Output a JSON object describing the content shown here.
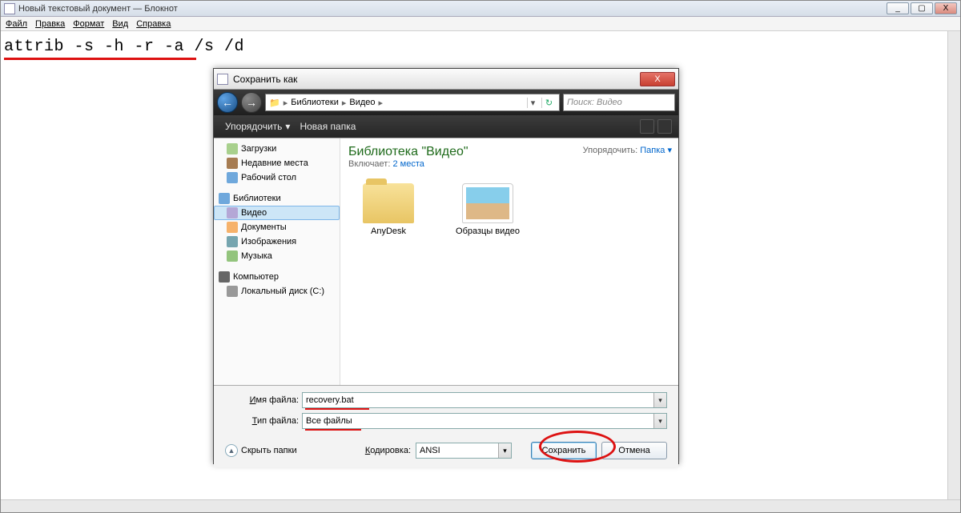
{
  "notepad": {
    "title": "Новый текстовый документ — Блокнот",
    "menu": {
      "file": "Файл",
      "edit": "Правка",
      "format": "Формат",
      "view": "Вид",
      "help": "Справка"
    },
    "command": "attrib -s -h -r -a /s /d",
    "ctrl": {
      "min": "_",
      "max": "▢",
      "close": "X"
    }
  },
  "dialog": {
    "title": "Сохранить как",
    "close_label": "X",
    "nav": {
      "back_glyph": "←",
      "fwd_glyph": "→"
    },
    "breadcrumb": {
      "icon": "📁",
      "seg1": "Библиотеки",
      "seg2": "Видео",
      "sep": "▸"
    },
    "search_placeholder": "Поиск: Видео",
    "toolbar": {
      "organize": "Упорядочить",
      "organize_arrow": "▾",
      "new_folder": "Новая папка"
    },
    "tree": {
      "downloads": "Загрузки",
      "recent": "Недавние места",
      "desktop": "Рабочий стол",
      "libraries": "Библиотеки",
      "video": "Видео",
      "documents": "Документы",
      "images": "Изображения",
      "music": "Музыка",
      "computer": "Компьютер",
      "local_disk": "Локальный диск (C:)"
    },
    "content": {
      "lib_title": "Библиотека \"Видео\"",
      "includes_label": "Включает:",
      "includes_link": "2 места",
      "arrange_label": "Упорядочить:",
      "arrange_value": "Папка",
      "arrange_arrow": "▾",
      "items": [
        {
          "name": "AnyDesk"
        },
        {
          "name": "Образцы видео"
        }
      ]
    },
    "fields": {
      "filename_label": "Имя файла:",
      "filename_value": "recovery.bat",
      "filetype_label": "Тип файла:",
      "filetype_value": "Все файлы"
    },
    "actions": {
      "hide_folders": "Скрыть папки",
      "encoding_label": "Кодировка:",
      "encoding_value": "ANSI",
      "save": "Сохранить",
      "cancel": "Отмена"
    }
  }
}
